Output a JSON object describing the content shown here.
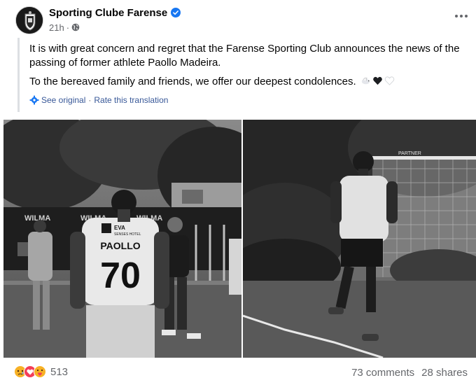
{
  "header": {
    "author": "Sporting Clube Farense",
    "time": "21h",
    "separator": "·"
  },
  "post": {
    "paragraph1": "It is with great concern and regret that the Farense Sporting Club announces the news of the passing of former athlete Paollo Madeira.",
    "paragraph2": "To the bereaved family and friends, we offer our deepest condolences.",
    "emojis": [
      "dove-emoji",
      "black-heart-emoji",
      "white-heart-emoji"
    ]
  },
  "translation": {
    "see_original": "See original",
    "separator": "·",
    "rate": "Rate this translation"
  },
  "photos": {
    "left": {
      "banner_text": "WILMA",
      "sponsor_text": "EVA",
      "sponsor_sub": "SENSES HOTEL",
      "jersey_name": "PAOLLO",
      "jersey_number": "70"
    },
    "right": {
      "fence_text": "PARTNER"
    }
  },
  "footer": {
    "reactions": [
      "sad-reaction-icon",
      "love-reaction-icon",
      "care-reaction-icon"
    ],
    "reaction_count": "513",
    "comments": "73 comments",
    "shares": "28 shares"
  },
  "colors": {
    "link": "#385898",
    "secondary_text": "#65676b",
    "verified_blue": "#1877f2"
  }
}
